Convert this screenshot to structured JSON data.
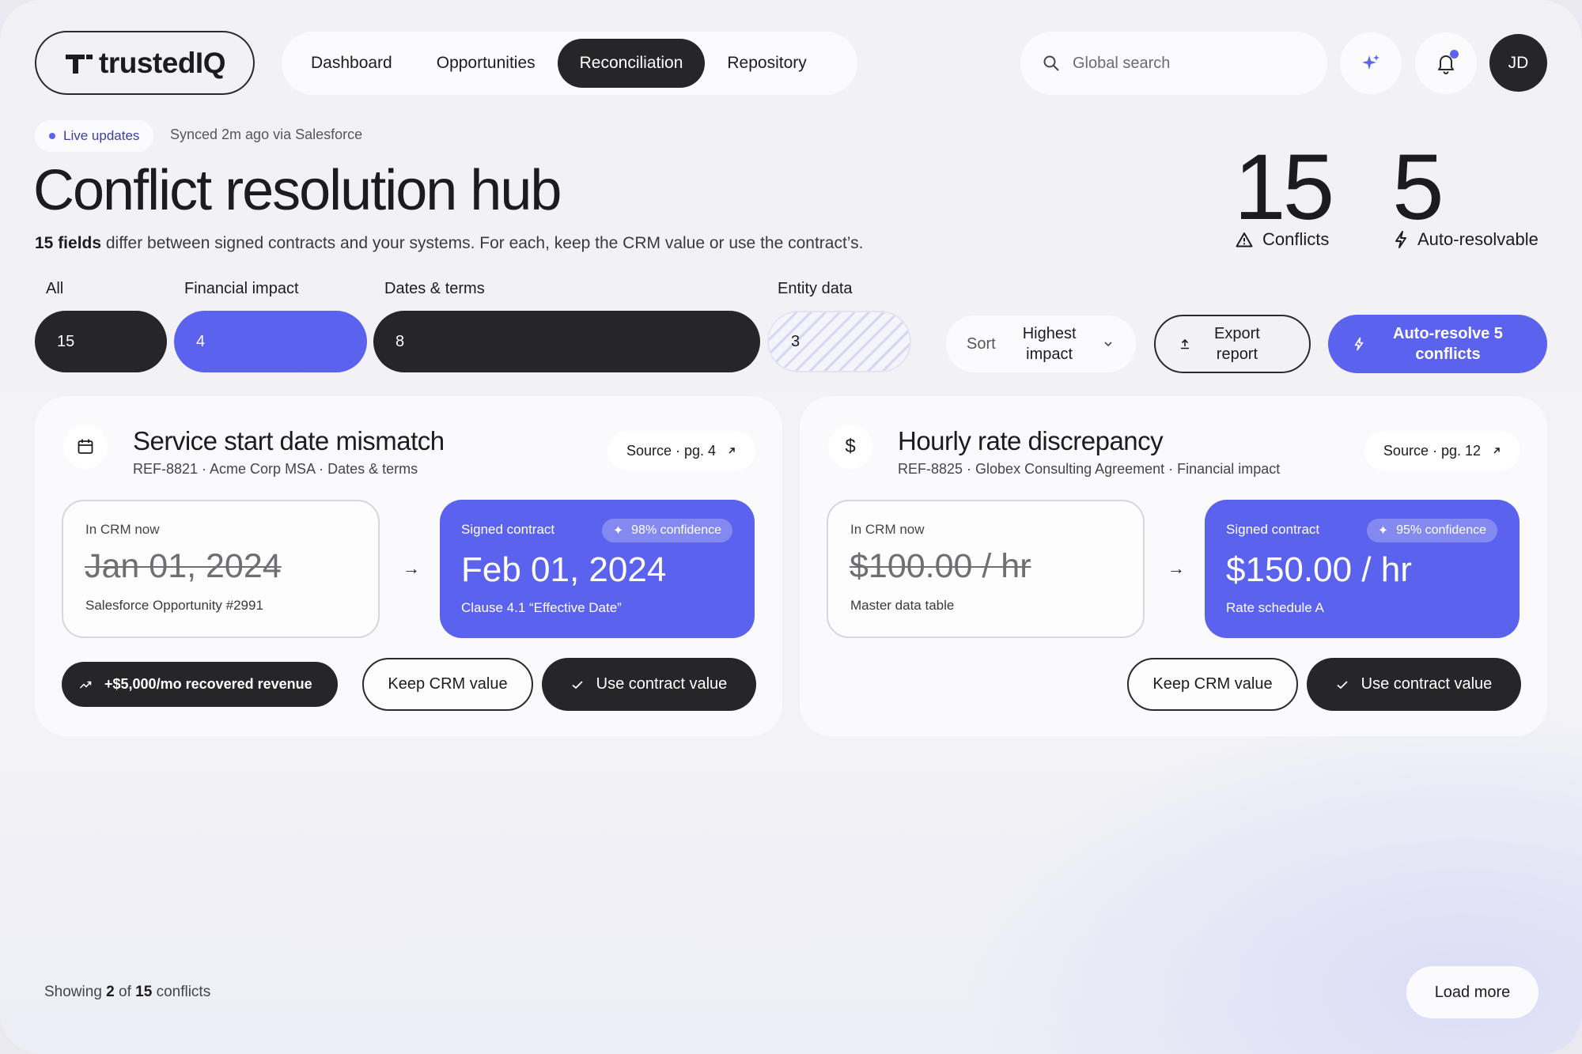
{
  "app": {
    "logo_text": "trustedIQ"
  },
  "nav": {
    "items": [
      {
        "label": "Dashboard",
        "active": false
      },
      {
        "label": "Opportunities",
        "active": false
      },
      {
        "label": "Reconciliation",
        "active": true
      },
      {
        "label": "Repository",
        "active": false
      }
    ]
  },
  "search": {
    "placeholder": "Global search"
  },
  "user": {
    "initials": "JD"
  },
  "header": {
    "live_label": "Live updates",
    "synced_text": "Synced 2m ago via Salesforce",
    "title": "Conflict resolution hub",
    "subtitle_bold": "15 fields",
    "subtitle_rest": " differ between signed contracts and your systems. For each, keep the CRM value or use the contract’s."
  },
  "stats": {
    "conflicts": {
      "value": "15",
      "label": "Conflicts"
    },
    "auto": {
      "value": "5",
      "label": "Auto-resolvable"
    }
  },
  "filters": [
    {
      "label": "All",
      "count": "15",
      "style": "dark"
    },
    {
      "label": "Financial impact",
      "count": "4",
      "style": "blue"
    },
    {
      "label": "Dates & terms",
      "count": "8",
      "style": "dark"
    },
    {
      "label": "Entity data",
      "count": "3",
      "style": "hatch"
    }
  ],
  "toolbar": {
    "sort_label": "Sort",
    "sort_value_line1": "Highest",
    "sort_value_line2": "impact",
    "export_line1": "Export",
    "export_line2": "report",
    "auto_line1": "Auto-resolve 5",
    "auto_line2": "conflicts"
  },
  "cards": [
    {
      "icon": "calendar-icon",
      "title": "Service start date mismatch",
      "meta": "REF-8821 · Acme Corp MSA · Dates & terms",
      "source": "Source · pg. 4",
      "crm_label": "In CRM now",
      "crm_value": "Jan 01, 2024",
      "crm_sub": "Salesforce Opportunity #2991",
      "contract_label": "Signed contract",
      "confidence": "98% confidence",
      "contract_value": "Feb 01, 2024",
      "contract_sub": "Clause 4.1 “Effective Date”",
      "impact": "+$5,000/mo recovered revenue",
      "keep_label": "Keep CRM value",
      "use_label": "Use contract value"
    },
    {
      "icon": "dollar-icon",
      "title": "Hourly rate discrepancy",
      "meta": "REF-8825 · Globex Consulting Agreement · Financial impact",
      "source": "Source · pg. 12",
      "crm_label": "In CRM now",
      "crm_value": "$100.00 / hr",
      "crm_sub": "Master data table",
      "contract_label": "Signed contract",
      "confidence": "95% confidence",
      "contract_value": "$150.00 / hr",
      "contract_sub": "Rate schedule A",
      "keep_label": "Keep CRM value",
      "use_label": "Use contract value"
    }
  ],
  "footer": {
    "showing_prefix": "Showing ",
    "showing_count": "2",
    "showing_of": " of ",
    "showing_total": "15",
    "showing_suffix": " conflicts",
    "load_more": "Load more"
  },
  "colors": {
    "accent": "#5b62ee",
    "dark": "#262628",
    "background": "#f2f2f5"
  }
}
